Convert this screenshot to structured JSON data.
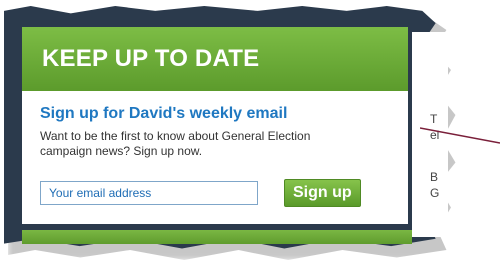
{
  "signup": {
    "title": "KEEP UP TO DATE",
    "headline": "Sign up for David's weekly email",
    "description": "Want to be the first to know about General Election campaign news? Sign up now.",
    "email_placeholder": "Your email address",
    "button_label": "Sign up"
  },
  "peek_text": {
    "line1": "T",
    "line2": "el",
    "line3": "B",
    "line4": "G"
  },
  "colors": {
    "header_green": "#6aab38",
    "headline_blue": "#1f78c1",
    "frame_navy": "#2b3a4c",
    "annotation_line": "#7a1f3a"
  }
}
